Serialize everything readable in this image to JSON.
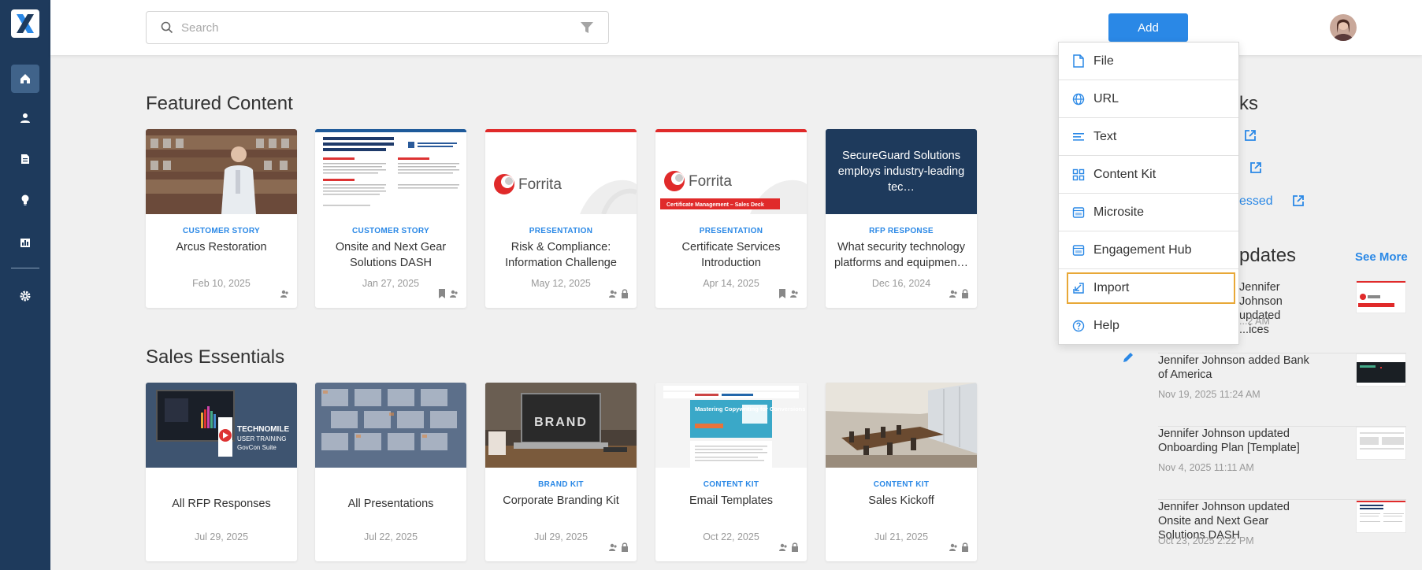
{
  "search": {
    "placeholder": "Search"
  },
  "header": {
    "add_label": "Add"
  },
  "featured": {
    "title": "Featured Content",
    "cards": [
      {
        "type": "CUSTOMER STORY",
        "title": "Arcus Restoration",
        "date": "Feb 10, 2025"
      },
      {
        "type": "CUSTOMER STORY",
        "title": "Onsite and Next Gear Solutions DASH",
        "date": "Jan 27, 2025"
      },
      {
        "type": "PRESENTATION",
        "title": "Risk & Compliance: Information Challenge",
        "date": "May 12, 2025"
      },
      {
        "type": "PRESENTATION",
        "title": "Certificate Services Introduction",
        "date": "Apr 14, 2025"
      },
      {
        "type": "RFP RESPONSE",
        "title": "What security technology platforms and equipmen…",
        "date": "Dec 16, 2024",
        "thumb_text": "SecureGuard Solutions employs industry-leading tec…"
      }
    ]
  },
  "sales": {
    "title": "Sales Essentials",
    "cards": [
      {
        "type": "",
        "title": "All RFP Responses",
        "date": "Jul 29, 2025"
      },
      {
        "type": "",
        "title": "All Presentations",
        "date": "Jul 22, 2025"
      },
      {
        "type": "BRAND KIT",
        "title": "Corporate Branding Kit",
        "date": "Jul 29, 2025"
      },
      {
        "type": "CONTENT KIT",
        "title": "Email Templates",
        "date": "Oct 22, 2025"
      },
      {
        "type": "CONTENT KIT",
        "title": "Sales Kickoff",
        "date": "Jul 21, 2025"
      }
    ]
  },
  "thumb_texts": {
    "forrita": "Forrita",
    "cert_banner": "Certificate Management – Sales Deck",
    "technomile": "TECHNOMILE",
    "technomile_sub": "USER TRAINING",
    "technomile_sub2": "GovCon Suite",
    "brand": "BRAND",
    "email_head": "Mastering Copywriting for Conversions"
  },
  "right": {
    "links_title_partial": "ks",
    "links": [
      {
        "text": ""
      },
      {
        "text": ""
      },
      {
        "text": "essed"
      }
    ],
    "updates_title_partial": "pdates",
    "see_more": "See More",
    "updates": [
      {
        "text": "Jennifer Johnson updated Certificate Services Introduction",
        "text_visible_1": "Jennifer Johnson updated",
        "text_visible_2": "...ices",
        "date": "...2 AM"
      },
      {
        "text": "Jennifer Johnson added Bank of America",
        "date": "Nov 19, 2025 11:24 AM"
      },
      {
        "text": "Jennifer Johnson updated Onboarding Plan [Template]",
        "date": "Nov 4, 2025 11:11 AM"
      },
      {
        "text": "Jennifer Johnson updated Onsite and Next Gear Solutions DASH",
        "date": "Oct 23, 2025 2:22 PM"
      }
    ]
  },
  "add_menu": {
    "items": [
      {
        "label": "File",
        "icon": "file-icon"
      },
      {
        "label": "URL",
        "icon": "globe-icon"
      },
      {
        "label": "Text",
        "icon": "text-lines-icon"
      },
      {
        "label": "Content Kit",
        "icon": "grid-icon"
      },
      {
        "label": "Microsite",
        "icon": "browser-icon"
      },
      {
        "label": "Engagement Hub",
        "icon": "browser-icon"
      },
      {
        "label": "Import",
        "icon": "import-icon",
        "highlighted": true
      },
      {
        "label": "Help",
        "icon": "help-circle-icon"
      }
    ]
  },
  "colors": {
    "sidebar": "#1e3a5c",
    "accent": "#2a88e6",
    "highlight": "#e8a838",
    "forrita_red": "#d32f2f"
  }
}
